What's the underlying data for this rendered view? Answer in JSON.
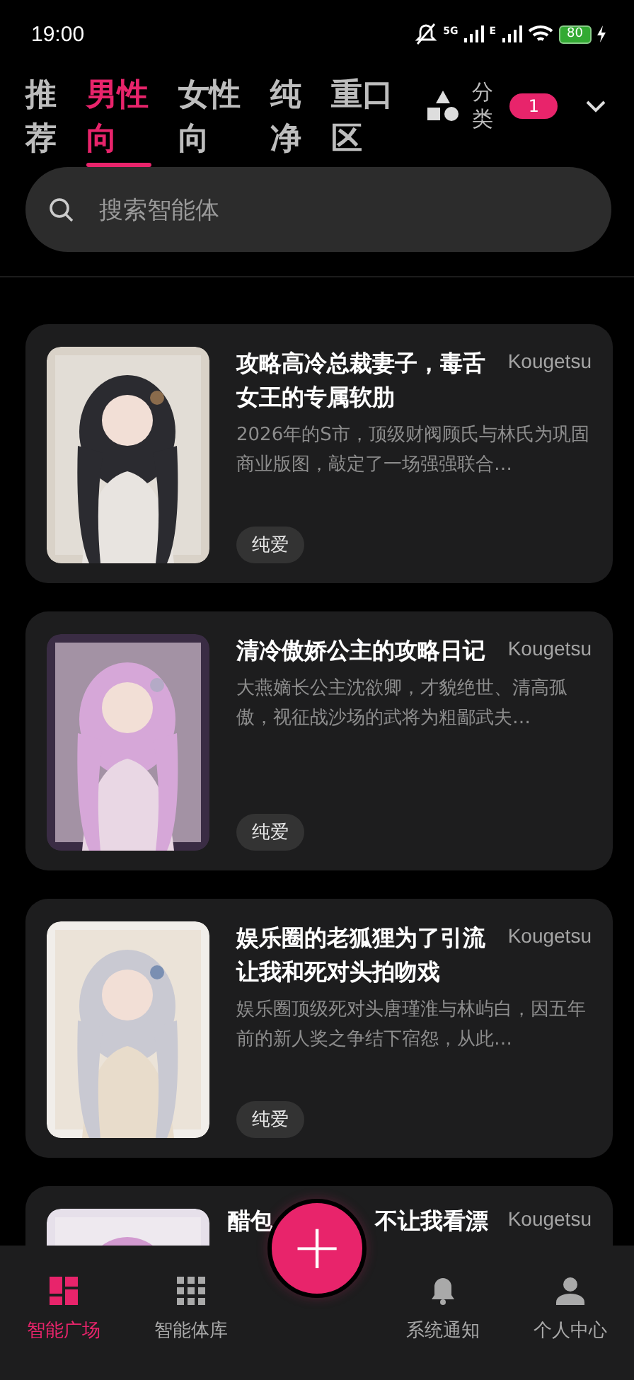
{
  "status_bar": {
    "time": "19:00",
    "network_1": "5G",
    "network_2": "E",
    "battery": "80"
  },
  "tabs": [
    {
      "label": "推荐",
      "selected": false
    },
    {
      "label": "男性向",
      "selected": true
    },
    {
      "label": "女性向",
      "selected": false
    },
    {
      "label": "纯净",
      "selected": false
    },
    {
      "label": "重口区",
      "selected": false
    }
  ],
  "category": {
    "label": "分类",
    "badge": "1"
  },
  "search": {
    "placeholder": "搜索智能体"
  },
  "cards": [
    {
      "title": "攻略高冷总裁妻子，毒舌女王的专属软肋",
      "author": "Kougetsu",
      "description": "2026年的S市，顶级财阀顾氏与林氏为巩固商业版图，敲定了一场强强联合…",
      "tag": "纯爱"
    },
    {
      "title": "清冷傲娇公主的攻略日记",
      "author": "Kougetsu",
      "description": "大燕嫡长公主沈欲卿，才貌绝世、清高孤傲，视征战沙场的武将为粗鄙武夫…",
      "tag": "纯爱"
    },
    {
      "title": "娱乐圈的老狐狸为了引流让我和死对头拍吻戏",
      "author": "Kougetsu",
      "description": "娱乐圈顶级死对头唐瑾淮与林屿白，因五年前的新人奖之争结下宿怨，从此…",
      "tag": "纯爱"
    },
    {
      "title_parts": [
        "醋包",
        "不让我看漂"
      ],
      "author": "Kougetsu"
    }
  ],
  "nav": [
    {
      "label": "智能广场",
      "selected": true
    },
    {
      "label": "智能体库",
      "selected": false
    },
    {
      "kind": "add",
      "label": "+"
    },
    {
      "label": "系统通知",
      "selected": false
    },
    {
      "label": "个人中心",
      "selected": false
    }
  ]
}
